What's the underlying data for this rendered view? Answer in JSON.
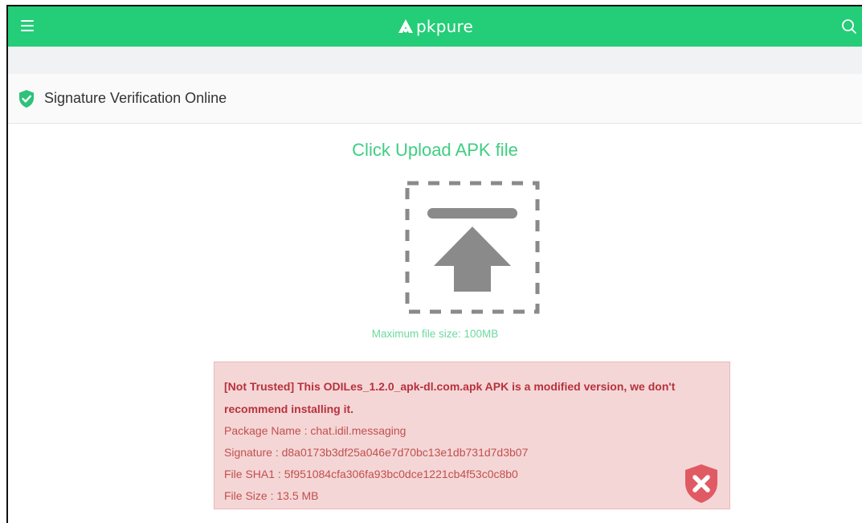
{
  "header": {
    "logo_text": "pkpure",
    "menu_icon": "menu-icon",
    "search_icon": "search-icon",
    "bg_color": "#24cd77"
  },
  "tool": {
    "title": "Signature Verification Online",
    "icon": "shield-check-icon"
  },
  "upload": {
    "title": "Click Upload APK file",
    "icon": "upload-arrow-icon",
    "max_size": "Maximum file size: 100MB"
  },
  "result": {
    "headline": "[Not Trusted] This ODILes_1.2.0_apk-dl.com.apk APK is a modified version, we don't recommend installing it.",
    "package_name": "Package Name : chat.idil.messaging",
    "signature": "Signature : d8a0173b3df25a046e7d70bc13e1db731d7d3b07",
    "file_sha1": "File SHA1 : 5f951084cfa306fa93bc0dce1221cb4f53c0c8b0",
    "file_size": "File Size : 13.5 MB",
    "status_icon": "shield-x-icon",
    "status_color": "#e05a64"
  }
}
